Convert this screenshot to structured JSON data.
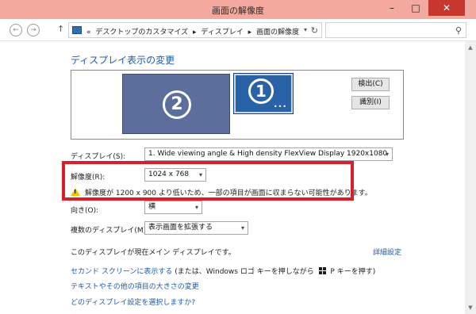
{
  "window": {
    "title": "画面の解像度",
    "minimize": "–",
    "maximize": "□",
    "close": "✕"
  },
  "nav": {
    "back": "←",
    "forward": "→",
    "up": "↑",
    "overflow": "«",
    "breadcrumb": [
      "デスクトップのカスタマイズ",
      "ディスプレイ",
      "画面の解像度"
    ],
    "separator": "▸",
    "dropdown": "▾",
    "refresh": "↻",
    "search_icon": "⚲"
  },
  "main": {
    "heading": "ディスプレイ表示の変更",
    "preview": {
      "monitor2": "2",
      "monitor1": "1",
      "monitor1_dots": "•••",
      "detect_label": "検出(C)",
      "identify_label": "識別(I)"
    },
    "display": {
      "label": "ディスプレイ(S):",
      "value": "1. Wide viewing angle & High density FlexView Display 1920x1080"
    },
    "resolution": {
      "label": "解像度(R):",
      "value": "1024 x 768"
    },
    "warning": "解像度が 1200 x 900 より低いため、一部の項目が画面に収まらない可能性があります。",
    "orientation": {
      "label": "向き(O):",
      "value": "横"
    },
    "multi": {
      "label": "複数のディスプレイ(M):",
      "value": "表示画面を拡張する"
    },
    "main_display_text": "このディスプレイが現在メイン ディスプレイです。",
    "advanced_link": "詳細設定",
    "second_screen": {
      "link": "セカンド スクリーンに表示する",
      "rest_before": " (または、Windows ロゴ キーを押しながら ",
      "rest_after": " P キーを押す)"
    },
    "text_size_link": "テキストやその他の項目の大きさの変更",
    "which_settings_link": "どのディスプレイ設定を選択しますか?"
  },
  "icons": {
    "warning": "warning-icon",
    "windows_logo": "windows-logo-icon",
    "monitor": "monitor-icon"
  },
  "colors": {
    "titlebar": "#f4a99f",
    "close": "#c7372f",
    "link": "#1d5bab",
    "highlight_box": "#d91f2b"
  }
}
